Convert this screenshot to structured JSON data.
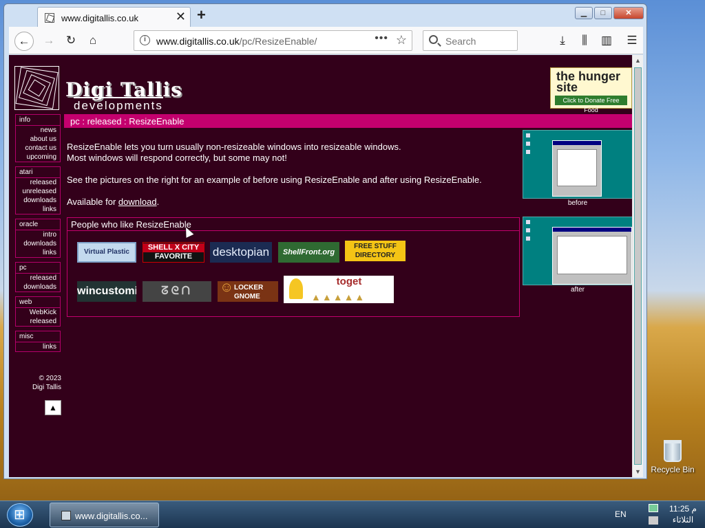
{
  "browser": {
    "tab_title": "www.digitallis.co.uk",
    "new_tab": "+",
    "url_host": "www.digitallis.co.uk",
    "url_path": "/pc/ResizeEnable/",
    "search_placeholder": "Search"
  },
  "site": {
    "brand_line1": "Digi Tallis",
    "brand_line2": "developments",
    "ad_title": "the hunger site",
    "ad_cta": "Click to Donate Free Food",
    "breadcrumb": "pc : released : ResizeEnable",
    "menus": [
      {
        "heading": "info",
        "items": [
          "news",
          "about us",
          "contact us",
          "upcoming"
        ]
      },
      {
        "heading": "atari",
        "items": [
          "released",
          "unreleased",
          "downloads",
          "links"
        ]
      },
      {
        "heading": "oracle",
        "items": [
          "intro",
          "downloads",
          "links"
        ]
      },
      {
        "heading": "pc",
        "items": [
          "released",
          "downloads"
        ]
      },
      {
        "heading": "web",
        "items": [
          "WebKick",
          "released"
        ]
      },
      {
        "heading": "misc",
        "items": [
          "links"
        ]
      }
    ],
    "copyright_line1": "© 2023",
    "copyright_line2": "Digi Tallis",
    "host_logo": "▲"
  },
  "content": {
    "para1_line1": "ResizeEnable lets you turn usually non-resizeable windows into resizeable windows.",
    "para1_line2": "Most windows will respond correctly, but some may not!",
    "para2": "See the pictures on the right for an example of before using ResizeEnable and after using ResizeEnable.",
    "para3_prefix": "Available for ",
    "download_link": "download",
    "para3_suffix": ".",
    "fans_heading": "People who like ResizeEnable",
    "badges": {
      "virtual_plastic": "Virtual Plastic .net",
      "shellcity_top": "SHELL X CITY",
      "shellcity_bottom": "FAVORITE",
      "desktopian": "desktopian",
      "shellfront": "ShellFront.org",
      "freestuff_top": "FREE STUFF",
      "freestuff_bottom": "DIRECTORY",
      "wincustomize": "wincustomize",
      "ezn": "ᘔᘓᑎ",
      "locker_top": "LOCKER",
      "locker_bottom": "GNOME",
      "toget": "toget"
    },
    "caption_before": "before",
    "caption_after": "after"
  },
  "desktop": {
    "recycle_bin": "Recycle Bin"
  },
  "taskbar": {
    "task_title": "www.digitallis.co...",
    "language": "EN",
    "time": "11:25 م",
    "day": "الثلاثاء"
  }
}
